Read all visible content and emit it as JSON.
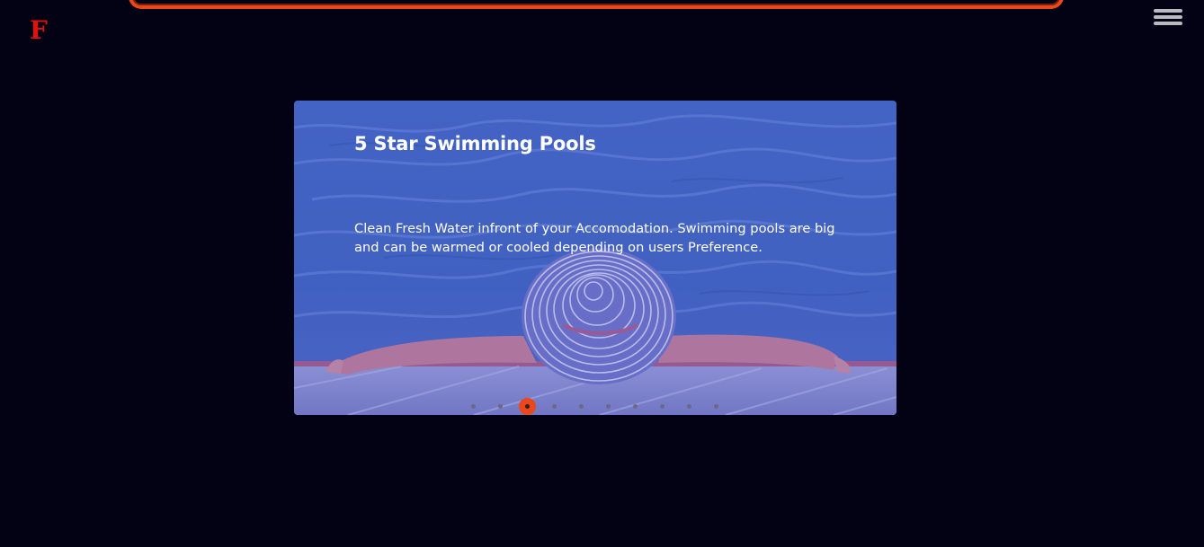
{
  "header": {
    "logo_text": "F",
    "menu_icon": "hamburger-menu-icon"
  },
  "carousel": {
    "title": "5 Star Swimming Pools",
    "description": "Clean Fresh Water infront of your Accomodation. Swimming pools are big and can be warmed or cooled depending on users Preference.",
    "slide_count": 10,
    "active_index": 2
  },
  "colors": {
    "background": "#020214",
    "accent": "#e8481c",
    "logo": "#e31010"
  }
}
